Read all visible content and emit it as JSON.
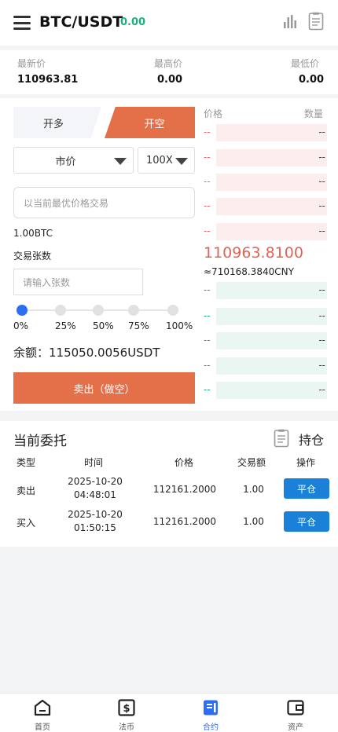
{
  "header": {
    "pair": "BTC/USDT",
    "change": "0.00"
  },
  "summary": [
    {
      "label": "最新价",
      "value": "110963.81"
    },
    {
      "label": "最高价",
      "value": "0.00"
    },
    {
      "label": "最低价",
      "value": "0.00"
    }
  ],
  "trade": {
    "tab_long": "开多",
    "tab_short": "开空",
    "order_type": "市价",
    "leverage": "100X",
    "price_placeholder": "以当前最优价格交易",
    "unit": "1.00BTC",
    "qty_label": "交易张数",
    "qty_placeholder": "请输入张数",
    "slider_value": 0,
    "percents": [
      "0%",
      "25%",
      "50%",
      "75%",
      "100%"
    ],
    "balance": "余额：115050.0056USDT",
    "sell_label": "卖出（做空）"
  },
  "orderbook": {
    "price_header": "价格",
    "qty_header": "数量",
    "asks": [
      {
        "price": "--",
        "qty": "--"
      },
      {
        "price": "--",
        "qty": "--"
      },
      {
        "price": "--",
        "qty": "--"
      },
      {
        "price": "--",
        "qty": "--"
      },
      {
        "price": "--",
        "qty": "--"
      }
    ],
    "last_price": "110963.8100",
    "cny": "≈710168.3840CNY",
    "bids": [
      {
        "price": "--",
        "qty": "--"
      },
      {
        "price": "--",
        "qty": "--"
      },
      {
        "price": "--",
        "qty": "--"
      },
      {
        "price": "--",
        "qty": "--"
      },
      {
        "price": "--",
        "qty": "--"
      }
    ]
  },
  "orders": {
    "title": "当前委托",
    "position_link": "持仓",
    "headers": [
      "类型",
      "时间",
      "价格",
      "交易额",
      "操作"
    ],
    "rows": [
      {
        "type": "卖出",
        "date": "2025-10-20",
        "time": "04:48:01",
        "price": "112161.2000",
        "amount": "1.00",
        "action": "平仓"
      },
      {
        "type": "买入",
        "date": "2025-10-20",
        "time": "01:50:15",
        "price": "112161.2000",
        "amount": "1.00",
        "action": "平仓"
      }
    ]
  },
  "nav": [
    {
      "label": "首页",
      "icon": "home-icon"
    },
    {
      "label": "法币",
      "icon": "dollar-icon"
    },
    {
      "label": "合约",
      "icon": "contract-icon"
    },
    {
      "label": "资产",
      "icon": "wallet-icon"
    }
  ],
  "colors": {
    "short": "#e4704a",
    "up": "#1bb17c",
    "accent": "#2c6df5",
    "button": "#1a80d8",
    "ask": "#e37266",
    "bid": "#2aa182"
  }
}
